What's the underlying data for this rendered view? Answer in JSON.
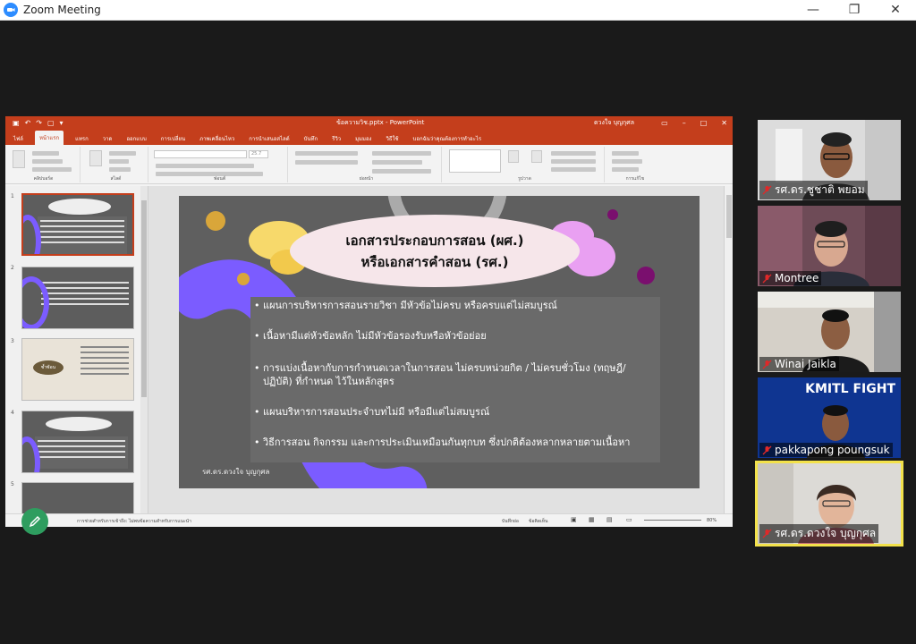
{
  "window": {
    "title": "Zoom Meeting",
    "min": "—",
    "max": "❐",
    "close": "✕"
  },
  "ppt": {
    "filename": "ข้อความวิช.pptx - PowerPoint",
    "user": "ดวงใจ บุญกุศล",
    "tabs": [
      "ไฟล์",
      "หน้าแรก",
      "แทรก",
      "วาด",
      "ออกแบบ",
      "การเปลี่ยน",
      "ภาพเคลื่อนไหว",
      "การนำเสนอสไลด์",
      "บันทึก",
      "รีวิว",
      "มุมมอง",
      "วิธีใช้",
      "บอกฉันว่าคุณต้องการทำอะไร"
    ],
    "ribbon_groups": [
      "คลิปบอร์ด",
      "สไลด์",
      "ฟอนต์",
      "ย่อหน้า",
      "รูปวาด",
      "การแก้ไข"
    ],
    "font_size": "25.7",
    "thumb_numbers": [
      "1",
      "2",
      "3",
      "4",
      "5"
    ],
    "thumb_badge": "ซ้ำซ้อน",
    "status": {
      "notes": "บันทึกย่อ",
      "comments": "ข้อคิดเห็น",
      "zoom": "80%",
      "info": "การช่วยสำหรับการเข้าถึง: ไม่พบข้อความสำหรับการแนะนำ"
    }
  },
  "slide": {
    "title_line1": "เอกสารประกอบการสอน (ผศ.)",
    "title_line2": "หรือเอกสารคำสอน (รศ.)",
    "bullets": [
      [
        "แผนการบริหารการสอนรายวิชา มีหัวข้อไม่ครบ หรือครบแต่ไม่สมบูรณ์"
      ],
      [
        "เนื้อหามีแต่หัวข้อหลัก ไม่มีหัวข้อรองรับหรือหัวข้อย่อย"
      ],
      [
        "การแบ่งเนื้อหากับการกำหนดเวลาในการสอน ไม่ครบหน่วยกิต / ไม่ครบชั่วโมง (ทฤษฎี/",
        "ปฏิบัติ) ที่กำหนด ไว้ในหลักสูตร"
      ],
      [
        "แผนบริหารการสอนประจำบทไม่มี หรือมีแต่ไม่สมบูรณ์"
      ],
      [
        "วิธีการสอน กิจกรรม และการประเมินเหมือนกันทุกบท ซึ่งปกติต้องหลากหลายตามเนื้อหา"
      ]
    ],
    "bullet_symbol": "•",
    "footer": "รศ.ดร.ดวงใจ บุญกุศล"
  },
  "participants": [
    {
      "name": "รศ.ดร.ชูชาติ  พยอม",
      "muted": true,
      "active": false
    },
    {
      "name": "Montree",
      "muted": true,
      "active": false
    },
    {
      "name": "Winai Jaikla",
      "muted": true,
      "active": false
    },
    {
      "name": "pakkapong poungsuk",
      "muted": true,
      "active": false,
      "bg_text": "KMITL FIGHT"
    },
    {
      "name": "รศ.ดร.ดวงใจ บุญกุศล",
      "muted": true,
      "active": true
    }
  ],
  "colors": {
    "ppt_red": "#c43e1c",
    "zoom_blue": "#2d8cff",
    "active_border": "#f3e24b",
    "annot_green": "#2e9d5f"
  }
}
